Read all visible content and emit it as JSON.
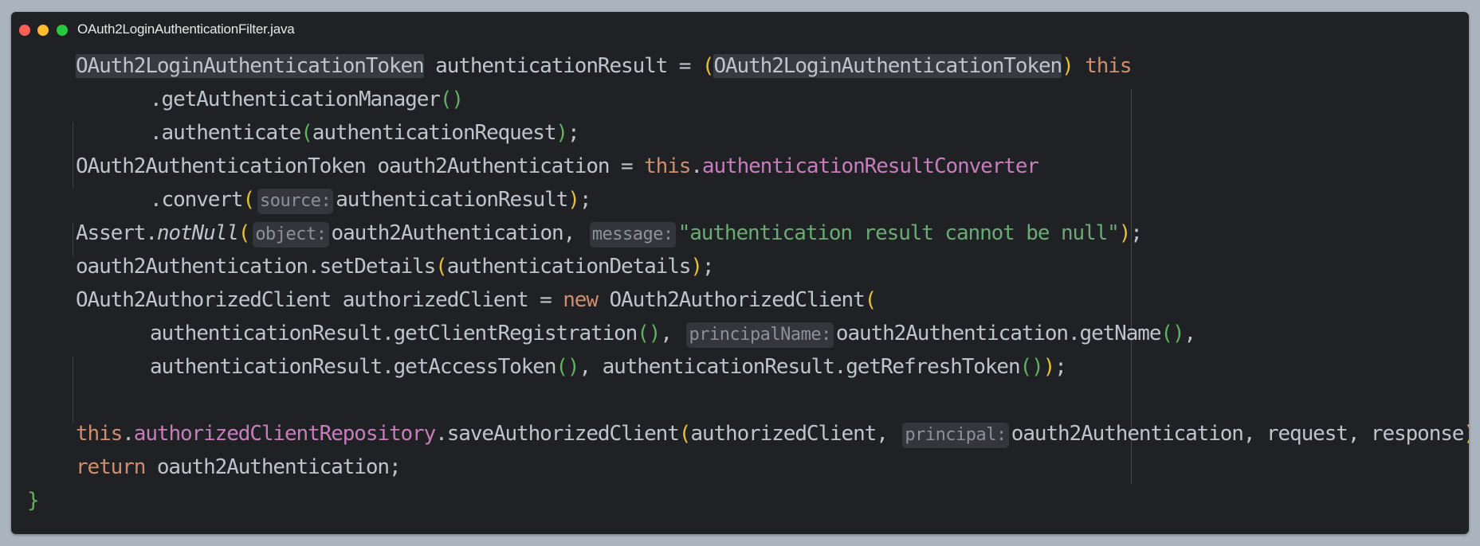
{
  "window": {
    "title": "OAuth2LoginAuthenticationFilter.java"
  },
  "colors": {
    "background": "#1f2125",
    "keyword": "#cf8e6d",
    "field": "#c77dbb",
    "string": "#6aab73",
    "paren_outer": "#e8bf3a",
    "paren_inner": "#5fb35f",
    "plain": "#bfc4cc"
  },
  "code": {
    "line1": {
      "t1": "OAuth2LoginAuthenticationToken",
      "t2": " authenticationResult = ",
      "t3": "(",
      "t4": "OAuth2LoginAuthenticationToken",
      "t5": ")",
      "t6": " ",
      "t7": "this"
    },
    "line2": {
      "t1": ".getAuthenticationManager",
      "t2": "()"
    },
    "line3": {
      "t1": ".authenticate",
      "t2": "(",
      "t3": "authenticationRequest",
      "t4": ")",
      "t5": ";"
    },
    "line4": {
      "t1": "OAuth2AuthenticationToken oauth2Authentication = ",
      "t2": "this",
      "t3": ".",
      "t4": "authenticationResultConverter"
    },
    "line5": {
      "t1": ".convert",
      "t2": "(",
      "hint": "source:",
      "t3": "authenticationResult",
      "t4": ")",
      "t5": ";"
    },
    "line6": {
      "t1": "Assert.",
      "t2": "notNull",
      "t3": "(",
      "hint1": "object:",
      "t4": "oauth2Authentication, ",
      "hint2": "message:",
      "t5": "\"authentication result cannot be null\"",
      "t6": ")",
      "t7": ";"
    },
    "line7": {
      "t1": "oauth2Authentication.setDetails",
      "t2": "(",
      "t3": "authenticationDetails",
      "t4": ")",
      "t5": ";"
    },
    "line8": {
      "t1": "OAuth2AuthorizedClient authorizedClient = ",
      "t2": "new",
      "t3": " OAuth2AuthorizedClient",
      "t4": "("
    },
    "line9": {
      "t1": "authenticationResult.getClientRegistration",
      "t2": "()",
      "t3": ", ",
      "hint": "principalName:",
      "t4": "oauth2Authentication.getName",
      "t5": "()",
      "t6": ","
    },
    "line10": {
      "t1": "authenticationResult.getAccessToken",
      "t2": "()",
      "t3": ", authenticationResult.getRefreshToken",
      "t4": "()",
      "t5": ")",
      "t6": ";"
    },
    "line11": {
      "t1": "this",
      "t2": ".",
      "t3": "authorizedClientRepository",
      "t4": ".saveAuthorizedClient",
      "t5": "(",
      "t6": "authorizedClient, ",
      "hint": "principal:",
      "t7": "oauth2Authentication, request, response",
      "t8": ")",
      "t9": ";"
    },
    "line12": {
      "t1": "return",
      "t2": " oauth2Authentication;"
    },
    "line13": {
      "t1": "}"
    }
  }
}
